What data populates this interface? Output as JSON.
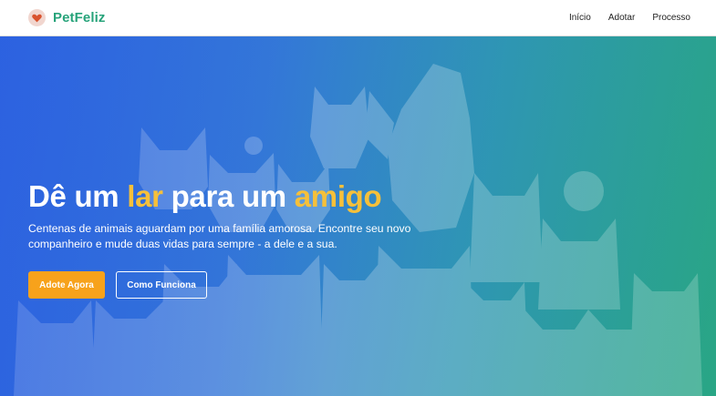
{
  "nav": {
    "brand": "PetFeliz",
    "logo_icon": "pet-heart-icon",
    "links": [
      {
        "label": "Início"
      },
      {
        "label": "Adotar"
      },
      {
        "label": "Processo"
      }
    ]
  },
  "hero": {
    "title_part1": "Dê um ",
    "title_accent1": "lar",
    "title_part2": " para um ",
    "title_accent2": "amigo",
    "subtitle": "Centenas de animais aguardam por uma família amorosa. Encontre seu novo companheiro e mude duas vidas para sempre - a dele e a sua.",
    "primary_cta": "Adote Agora",
    "secondary_cta": "Como Funciona",
    "background_image": "group-of-cats-and-dog-photo"
  },
  "colors": {
    "brand": "#27a37a",
    "accent": "#f6c03a",
    "cta": "#f7a21b",
    "hero_gradient_start": "#2f66e3",
    "hero_gradient_end": "#29a587"
  }
}
